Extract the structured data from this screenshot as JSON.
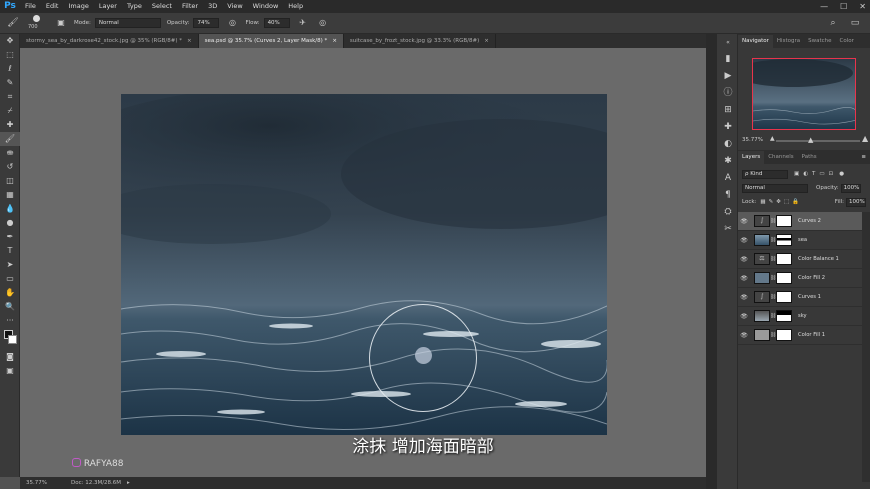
{
  "menubar": {
    "logo": "Ps",
    "items": [
      "File",
      "Edit",
      "Image",
      "Layer",
      "Type",
      "Select",
      "Filter",
      "3D",
      "View",
      "Window",
      "Help"
    ],
    "window_controls": [
      "—",
      "☐",
      "✕"
    ]
  },
  "options": {
    "brush_size": "700",
    "mode_label": "Mode:",
    "mode_value": "Normal",
    "opacity_label": "Opacity:",
    "opacity_value": "74%",
    "flow_label": "Flow:",
    "flow_value": "40%"
  },
  "tabs": [
    {
      "label": "stormy_sea_by_darkrose42_stock.jpg @ 35% (RGB/8#) *"
    },
    {
      "label": "sea.psd @ 35.7% (Curves 2, Layer Mask/8) *"
    },
    {
      "label": "suitcase_by_frozt_stock.jpg @ 33.3% (RGB/8#)"
    }
  ],
  "status": {
    "zoom": "35.77%",
    "doc": "Doc: 12.3M/28.6M"
  },
  "subtitle": "涂抹  增加海面暗部",
  "watermark": "RAFYA88",
  "navigator": {
    "tabs": [
      "Navigator",
      "Histogra",
      "Swatche",
      "Color"
    ],
    "zoom": "35.77%"
  },
  "layers_panel": {
    "tabs": [
      "Layers",
      "Channels",
      "Paths"
    ],
    "kind_label": "ρ Kind",
    "blend_mode": "Normal",
    "opacity_label": "Opacity:",
    "opacity_value": "100%",
    "lock_label": "Lock:",
    "fill_label": "Fill:",
    "fill_value": "100%",
    "layers": [
      {
        "name": "Curves 2",
        "selected": true,
        "thumb": "curves"
      },
      {
        "name": "sea",
        "selected": false,
        "thumb": "sea"
      },
      {
        "name": "Color Balance 1",
        "selected": false,
        "thumb": "balance"
      },
      {
        "name": "Color Fill 2",
        "selected": false,
        "thumb": "fill2"
      },
      {
        "name": "Curves 1",
        "selected": false,
        "thumb": "curves"
      },
      {
        "name": "sky",
        "selected": false,
        "thumb": "sky"
      },
      {
        "name": "Color Fill 1",
        "selected": false,
        "thumb": "fill1"
      }
    ]
  },
  "colors": {
    "accent_ps": "#31a8ff",
    "nav_frame": "#e8344c",
    "watermark_brand": "#2fa54a"
  }
}
